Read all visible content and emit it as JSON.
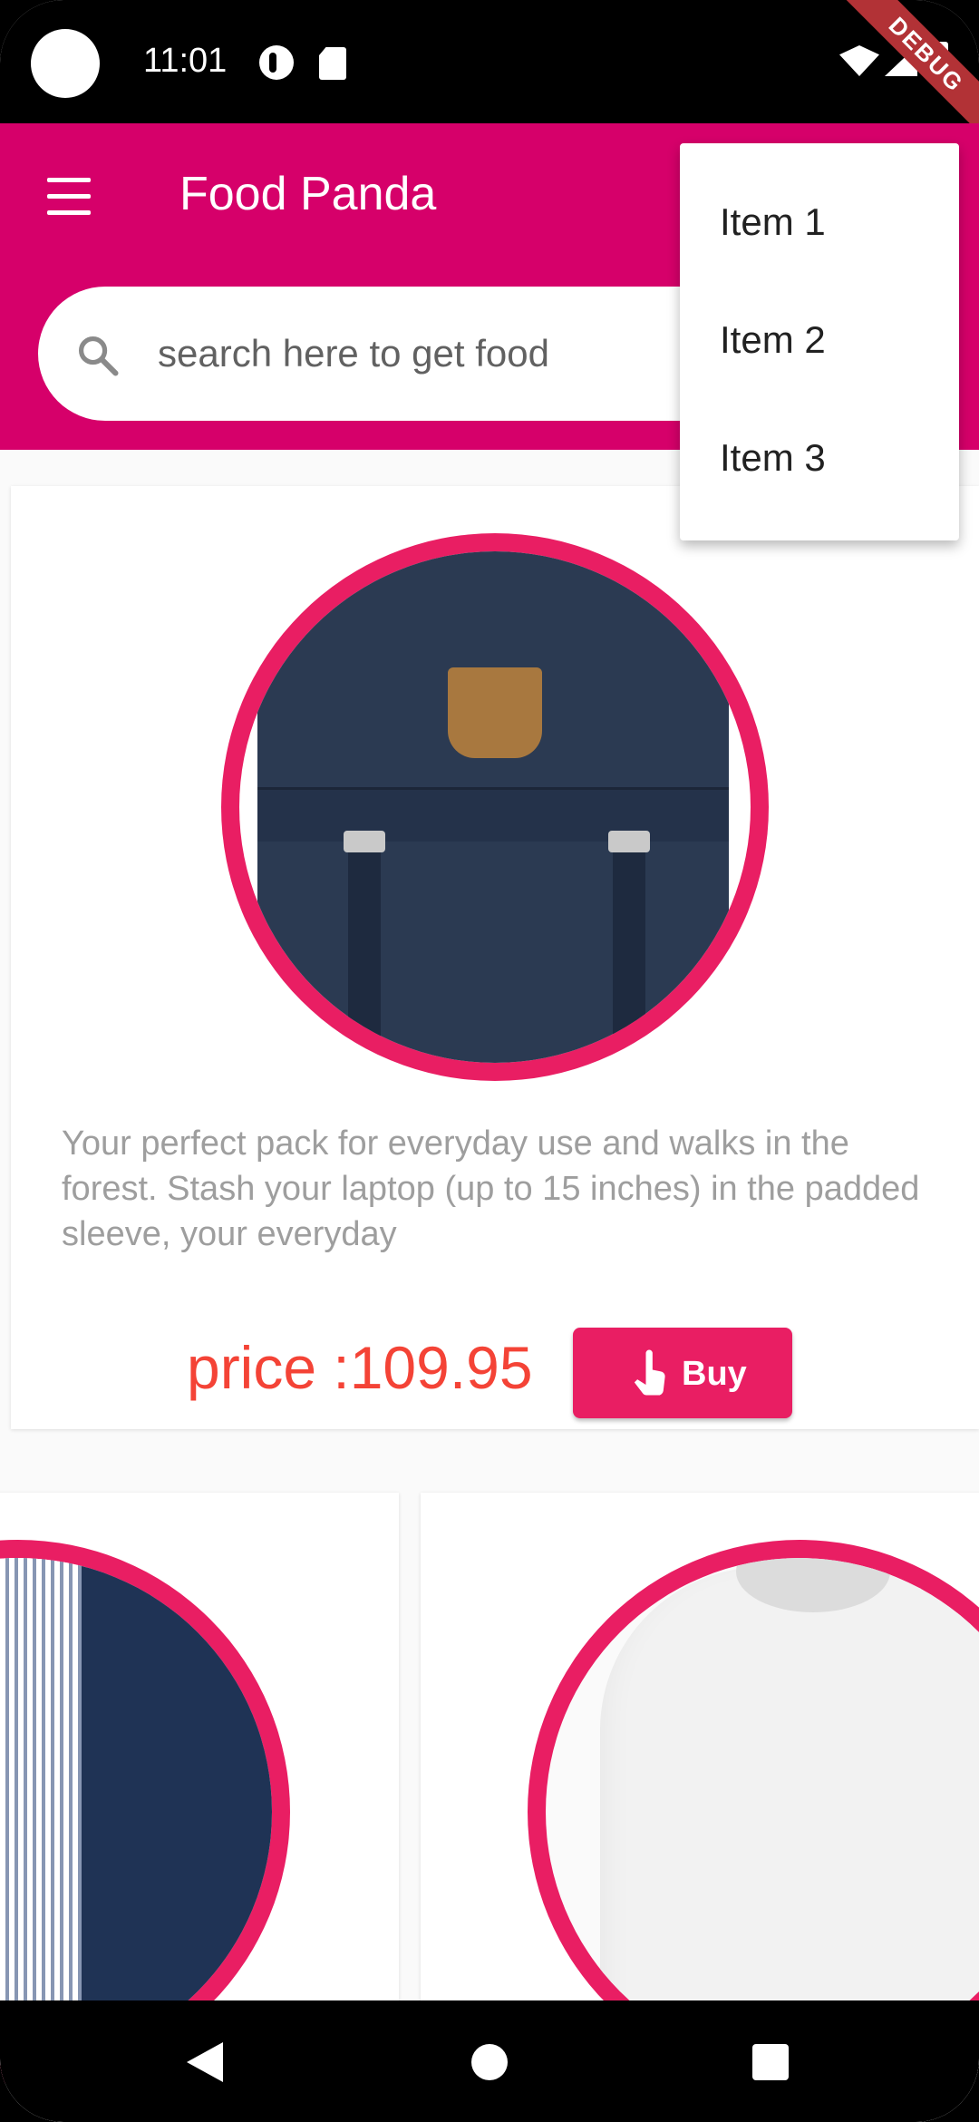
{
  "status_bar": {
    "time": "11:01",
    "debug_label": "DEBUG"
  },
  "app_bar": {
    "title": "Food Panda",
    "menu_icon": "hamburger-menu-icon",
    "color": "#d6006a"
  },
  "search": {
    "placeholder": "search here to get food",
    "icon": "search-icon"
  },
  "popup_menu": {
    "items": [
      "Item 1",
      "Item 2",
      "Item 3"
    ]
  },
  "product": {
    "description": "Your perfect pack for everyday use and walks in the forest. Stash your laptop (up to 15 inches) in the padded sleeve, your everyday",
    "price_text": "price :109.95",
    "buy_label": "Buy",
    "buy_icon": "touch-hand-icon",
    "accent_color": "#e91e63",
    "price_color": "#f44336"
  },
  "nav_bar": {
    "back_icon": "back-triangle-icon",
    "home_icon": "home-circle-icon",
    "recents_icon": "recents-square-icon"
  }
}
